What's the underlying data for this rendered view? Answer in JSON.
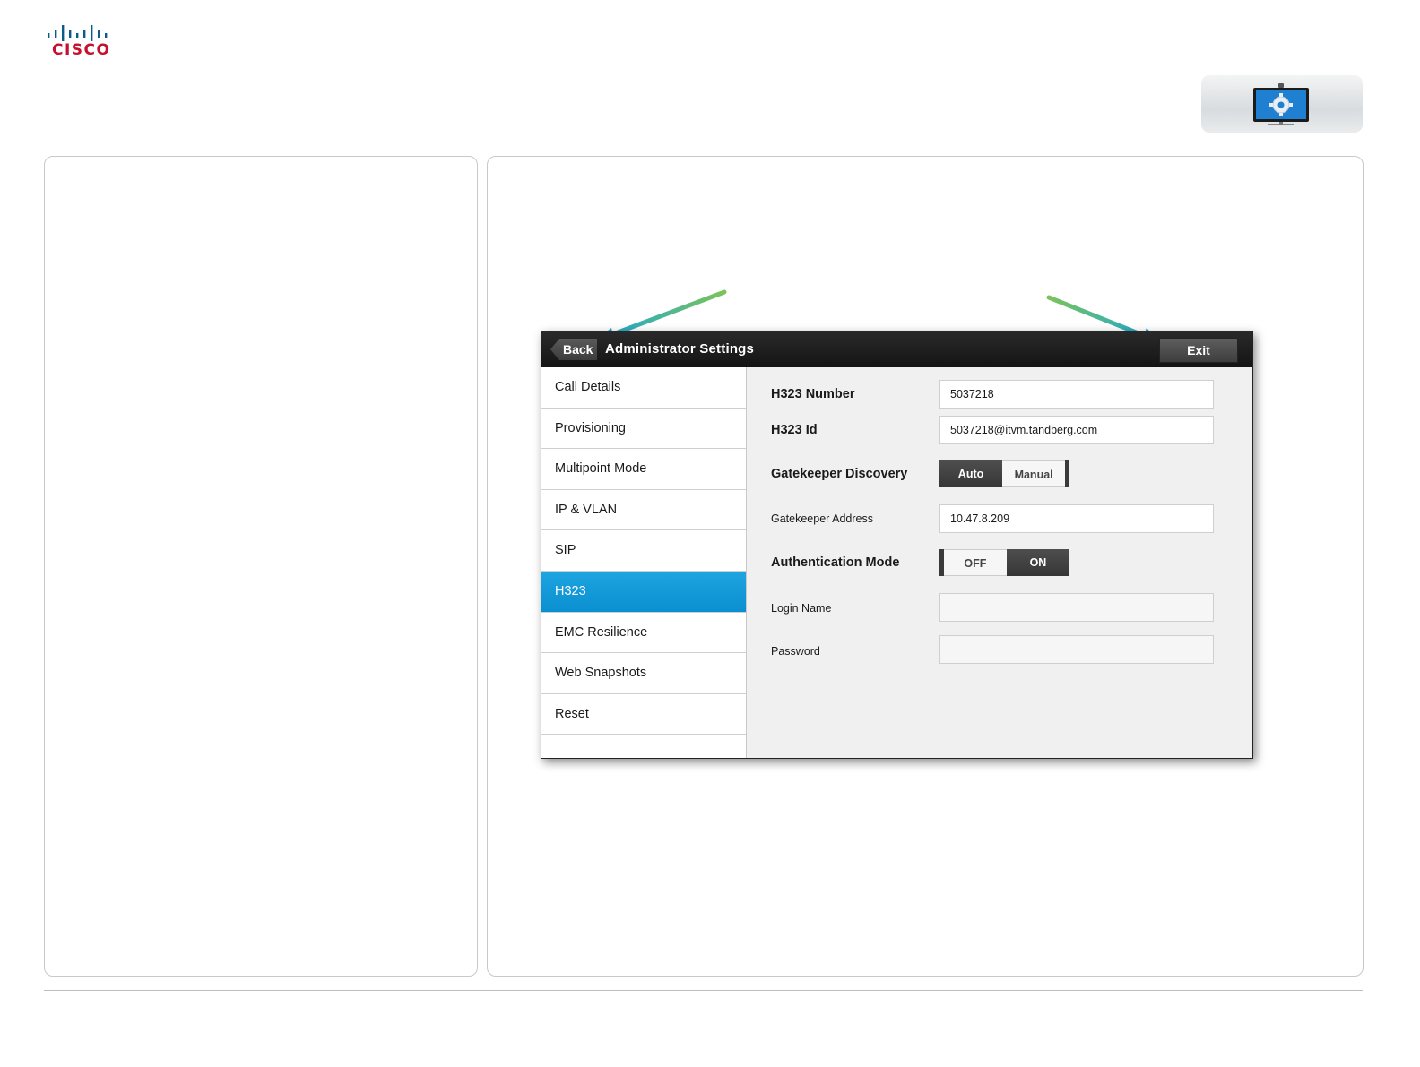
{
  "brand": {
    "name": "CISCO",
    "accent": "#c5102e",
    "bars_color": "#0b5c8a"
  },
  "badge": {
    "icon": "monitor-settings-icon"
  },
  "screen": {
    "title": "Administrator Settings",
    "back_label": "Back",
    "exit_label": "Exit",
    "menu": [
      {
        "label": "Call Details",
        "active": false
      },
      {
        "label": "Provisioning",
        "active": false
      },
      {
        "label": "Multipoint Mode",
        "active": false
      },
      {
        "label": "IP & VLAN",
        "active": false
      },
      {
        "label": "SIP",
        "active": false
      },
      {
        "label": "H323",
        "active": true
      },
      {
        "label": "EMC Resilience",
        "active": false
      },
      {
        "label": "Web Snapshots",
        "active": false
      },
      {
        "label": "Reset",
        "active": false
      }
    ],
    "settings": {
      "h323_number": {
        "label": "H323 Number",
        "value": "5037218"
      },
      "h323_id": {
        "label": "H323 Id",
        "value": "5037218@itvm.tandberg.com"
      },
      "gatekeeper_discovery": {
        "label": "Gatekeeper Discovery",
        "options": [
          "Auto",
          "Manual"
        ],
        "selected": "Auto"
      },
      "gatekeeper_address": {
        "label": "Gatekeeper Address",
        "value": "10.47.8.209"
      },
      "authentication_mode": {
        "label": "Authentication Mode",
        "options": [
          "OFF",
          "ON"
        ],
        "selected": "ON"
      },
      "login_name": {
        "label": "Login Name",
        "value": ""
      },
      "password": {
        "label": "Password",
        "value": ""
      }
    }
  },
  "colors": {
    "active_menu": "#0a8fd0",
    "arrow_start": "#7cc35a",
    "arrow_end": "#18a7d8"
  }
}
